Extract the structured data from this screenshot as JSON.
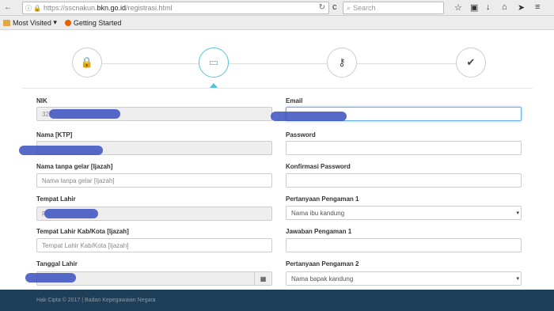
{
  "browser": {
    "url_prefix": "https://sscnakun.",
    "url_domain": "bkn.go.id",
    "url_suffix": "/registrasi.html",
    "search_placeholder": "Search",
    "bookmarks": [
      "Most Visited",
      "Getting Started"
    ]
  },
  "form": {
    "left": {
      "nik_label": "NIK",
      "nik_value": "327",
      "nama_ktp_label": "Nama [KTP]",
      "nama_gelar_label": "Nama tanpa gelar [Ijazah]",
      "nama_gelar_placeholder": "Nama tanpa gelar [Ijazah]",
      "tempat_lahir_label": "Tempat Lahir",
      "tempat_lahir_value": "P",
      "tempat_lahir_kab_label": "Tempat Lahir Kab/Kota [Ijazah]",
      "tempat_lahir_kab_placeholder": "Tempat Lahir Kab/Kota [Ijazah]",
      "tanggal_lahir_label": "Tanggal Lahir"
    },
    "right": {
      "email_label": "Email",
      "password_label": "Password",
      "konfirmasi_label": "Konfirmasi Password",
      "pertanyaan1_label": "Pertanyaan Pengaman 1",
      "pertanyaan1_value": "Nama ibu kandung",
      "jawaban1_label": "Jawaban Pengaman 1",
      "pertanyaan2_label": "Pertanyaan Pengaman 2",
      "pertanyaan2_value": "Nama bapak kandung"
    }
  },
  "footer": {
    "text": "Hak Cipta © 2017 | Badan Kepegawaian Negara"
  },
  "colors": {
    "accent": "#5bc0de",
    "footer_bg": "#1f3e57"
  }
}
